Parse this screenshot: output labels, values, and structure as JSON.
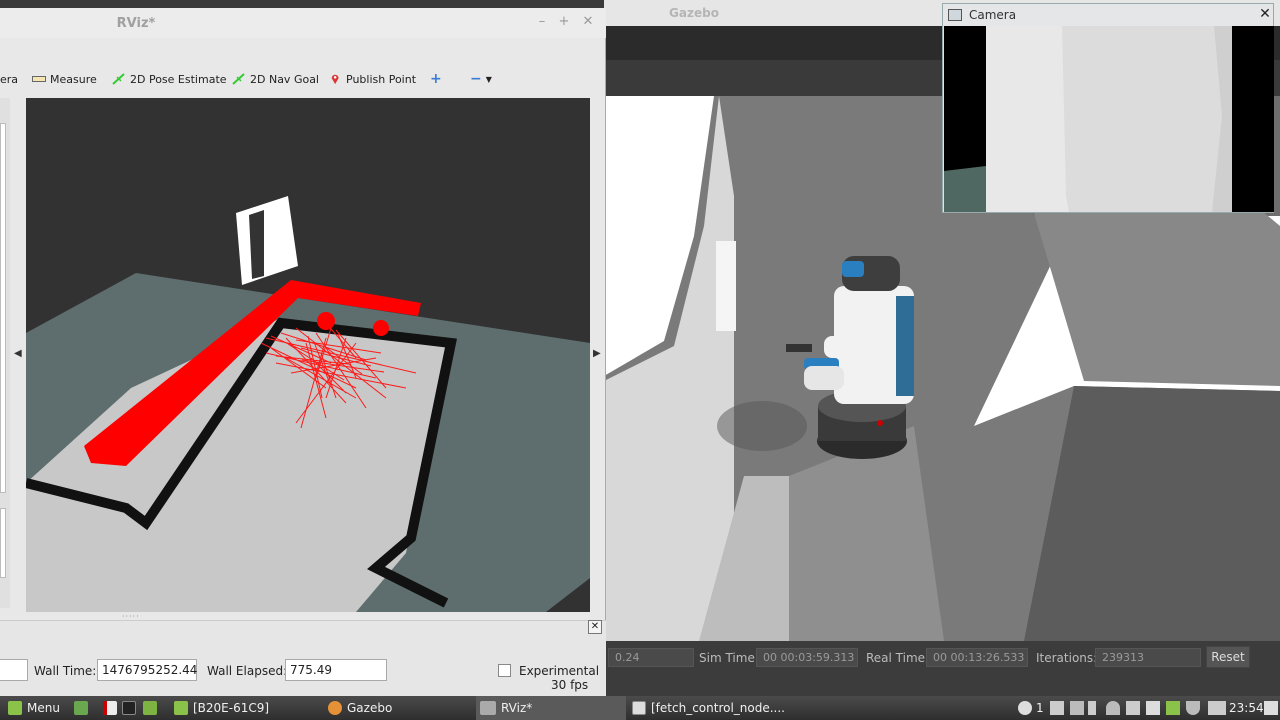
{
  "rviz": {
    "title": "RViz*",
    "toolbar": {
      "camera_partial": "era",
      "measure": "Measure",
      "pose_estimate": "2D Pose Estimate",
      "nav_goal": "2D Nav Goal",
      "publish_point": "Publish Point"
    },
    "time": {
      "wall_time_label": "Wall Time:",
      "wall_time_value": "1476795252.44",
      "wall_elapsed_label": "Wall Elapsed:",
      "wall_elapsed_value": "775.49",
      "experimental_label": "Experimental",
      "fps": "30 fps"
    }
  },
  "gazebo": {
    "title": "Gazebo",
    "status": {
      "rtf_value": "0.24",
      "sim_time_label": "Sim Time:",
      "sim_time_value": "00 00:03:59.313",
      "real_time_label": "Real Time:",
      "real_time_value": "00 00:13:26.533",
      "iterations_label": "Iterations:",
      "iterations_value": "239313",
      "reset_label": "Reset"
    }
  },
  "camera": {
    "title": "Camera"
  },
  "taskbar": {
    "menu_label": "Menu",
    "items": [
      {
        "label": "[B20E-61C9]"
      },
      {
        "label": "Gazebo"
      },
      {
        "label": "RViz*"
      },
      {
        "label": "[fetch_control_node...."
      }
    ],
    "tray_count": "1",
    "clock": "23:54"
  }
}
